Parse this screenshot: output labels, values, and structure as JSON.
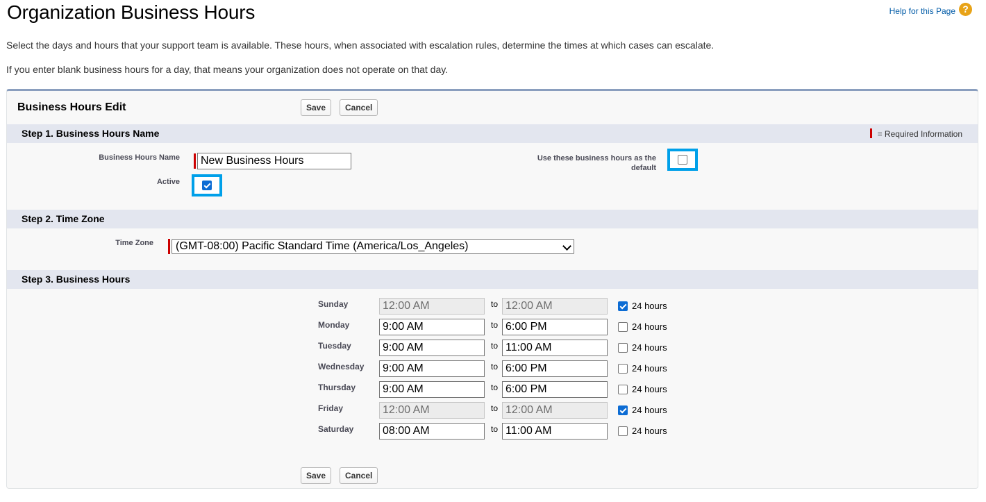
{
  "page": {
    "title": "Organization Business Hours",
    "help_link": "Help for this Page",
    "help_icon": "question-icon",
    "description1": "Select the days and hours that your support team is available. These hours, when associated with escalation rules, determine the times at which cases can escalate.",
    "description2": "If you enter blank business hours for a day, that means your organization does not operate on that day."
  },
  "panel": {
    "title": "Business Hours Edit",
    "save_label": "Save",
    "cancel_label": "Cancel"
  },
  "step1": {
    "title": "Step 1. Business Hours Name",
    "required_legend": "= Required Information",
    "name_label": "Business Hours Name",
    "name_value": "New Business Hours",
    "active_label": "Active",
    "active_checked": true,
    "default_label_line1": "Use these business hours as the",
    "default_label_line2": "default",
    "default_checked": false
  },
  "step2": {
    "title": "Step 2. Time Zone",
    "tz_label": "Time Zone",
    "tz_value": "(GMT-08:00) Pacific Standard Time (America/Los_Angeles)"
  },
  "step3": {
    "title": "Step 3. Business Hours",
    "to_label": "to",
    "hours24_label": "24 hours",
    "days": [
      {
        "name": "Sunday",
        "start": "12:00 AM",
        "end": "12:00 AM",
        "all_day": true
      },
      {
        "name": "Monday",
        "start": "9:00 AM",
        "end": "6:00 PM",
        "all_day": false
      },
      {
        "name": "Tuesday",
        "start": "9:00 AM",
        "end": "11:00 AM",
        "all_day": false
      },
      {
        "name": "Wednesday",
        "start": "9:00 AM",
        "end": "6:00 PM",
        "all_day": false
      },
      {
        "name": "Thursday",
        "start": "9:00 AM",
        "end": "6:00 PM",
        "all_day": false
      },
      {
        "name": "Friday",
        "start": "12:00 AM",
        "end": "12:00 AM",
        "all_day": true
      },
      {
        "name": "Saturday",
        "start": "08:00 AM",
        "end": "11:00 AM",
        "all_day": false
      }
    ]
  },
  "colors": {
    "accent_highlight": "#00a0e9",
    "checkbox_checked": "#0c6cd4",
    "required_marker": "#cc0000",
    "section_bar": "#e3e6ef"
  }
}
